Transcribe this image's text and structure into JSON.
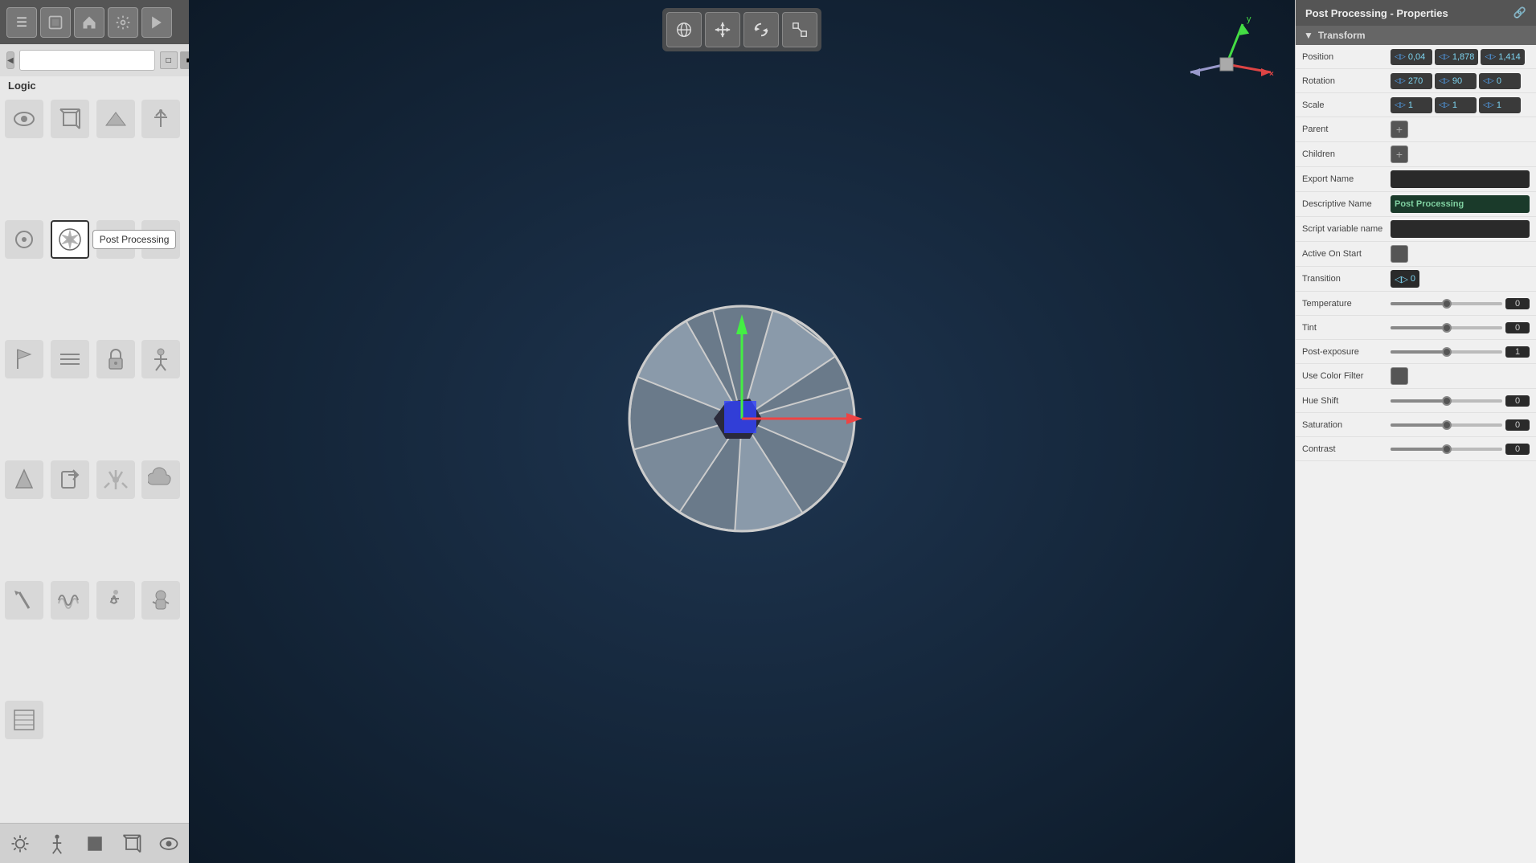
{
  "app": {
    "title": "Post Processing - Properties"
  },
  "left_panel": {
    "logic_label": "Logic",
    "search_placeholder": "",
    "tooltip_text": "Post Processing",
    "icons": [
      {
        "name": "eye-icon",
        "symbol": "👁"
      },
      {
        "name": "cube-icon",
        "symbol": "⬛"
      },
      {
        "name": "plane-icon",
        "symbol": "⬜"
      },
      {
        "name": "antenna-icon",
        "symbol": "📡"
      },
      {
        "name": "circle-icon",
        "symbol": "⭕"
      },
      {
        "name": "post-processing-icon",
        "symbol": "◎"
      },
      {
        "name": "sphere-icon",
        "symbol": "🔵"
      },
      {
        "name": "unknown1-icon",
        "symbol": "⚙"
      },
      {
        "name": "flag-icon",
        "symbol": "🚩"
      },
      {
        "name": "fog-icon",
        "symbol": "≡"
      },
      {
        "name": "lock-icon",
        "symbol": "🔒"
      },
      {
        "name": "character-icon",
        "symbol": "🚶"
      },
      {
        "name": "cone-icon",
        "symbol": "⚠"
      },
      {
        "name": "export-icon",
        "symbol": "↗"
      },
      {
        "name": "radiation-icon",
        "symbol": "☢"
      },
      {
        "name": "cloud-icon",
        "symbol": "☁"
      },
      {
        "name": "brush-icon",
        "symbol": "🖌"
      },
      {
        "name": "wave-icon",
        "symbol": "〰"
      },
      {
        "name": "walker-icon",
        "symbol": "🚶"
      },
      {
        "name": "astronaut-icon",
        "symbol": "👨‍🚀"
      },
      {
        "name": "stripes-icon",
        "symbol": "▦"
      }
    ]
  },
  "toolbar": {
    "buttons": [
      "☰",
      "⬛",
      "🏠",
      "⚙",
      "▶"
    ],
    "view_buttons": [
      "□",
      "■",
      "◻"
    ]
  },
  "viewport_toolbar": {
    "buttons": [
      "🌐",
      "✛",
      "↺",
      "⊡"
    ]
  },
  "right_panel": {
    "title": "Post Processing - Properties",
    "transform_label": "Transform",
    "properties": {
      "position_label": "Position",
      "position_x": "0,04",
      "position_y": "1,878",
      "position_z": "1,414",
      "rotation_label": "Rotation",
      "rotation_x": "270",
      "rotation_y": "90",
      "rotation_z": "0",
      "scale_label": "Scale",
      "scale_x": "1",
      "scale_y": "1",
      "scale_z": "1",
      "parent_label": "Parent",
      "children_label": "Children",
      "export_name_label": "Export Name",
      "export_name_value": "",
      "descriptive_name_label": "Descriptive Name",
      "descriptive_name_value": "Post Processing",
      "script_variable_label": "Script variable name",
      "script_variable_value": "",
      "active_on_start_label": "Active On Start",
      "transition_label": "Transition",
      "transition_value": "0",
      "temperature_label": "Temperature",
      "temperature_value": "0",
      "tint_label": "Tint",
      "tint_value": "0",
      "post_exposure_label": "Post-exposure",
      "post_exposure_value": "1",
      "use_color_filter_label": "Use Color Filter",
      "hue_shift_label": "Hue Shift",
      "hue_shift_value": "0",
      "saturation_label": "Saturation",
      "saturation_value": "0",
      "contrast_label": "Contrast",
      "contrast_value": "0"
    }
  },
  "bottom_bar": {
    "icons": [
      "☀",
      "🚶",
      "⬛",
      "⬜",
      "👁"
    ]
  }
}
